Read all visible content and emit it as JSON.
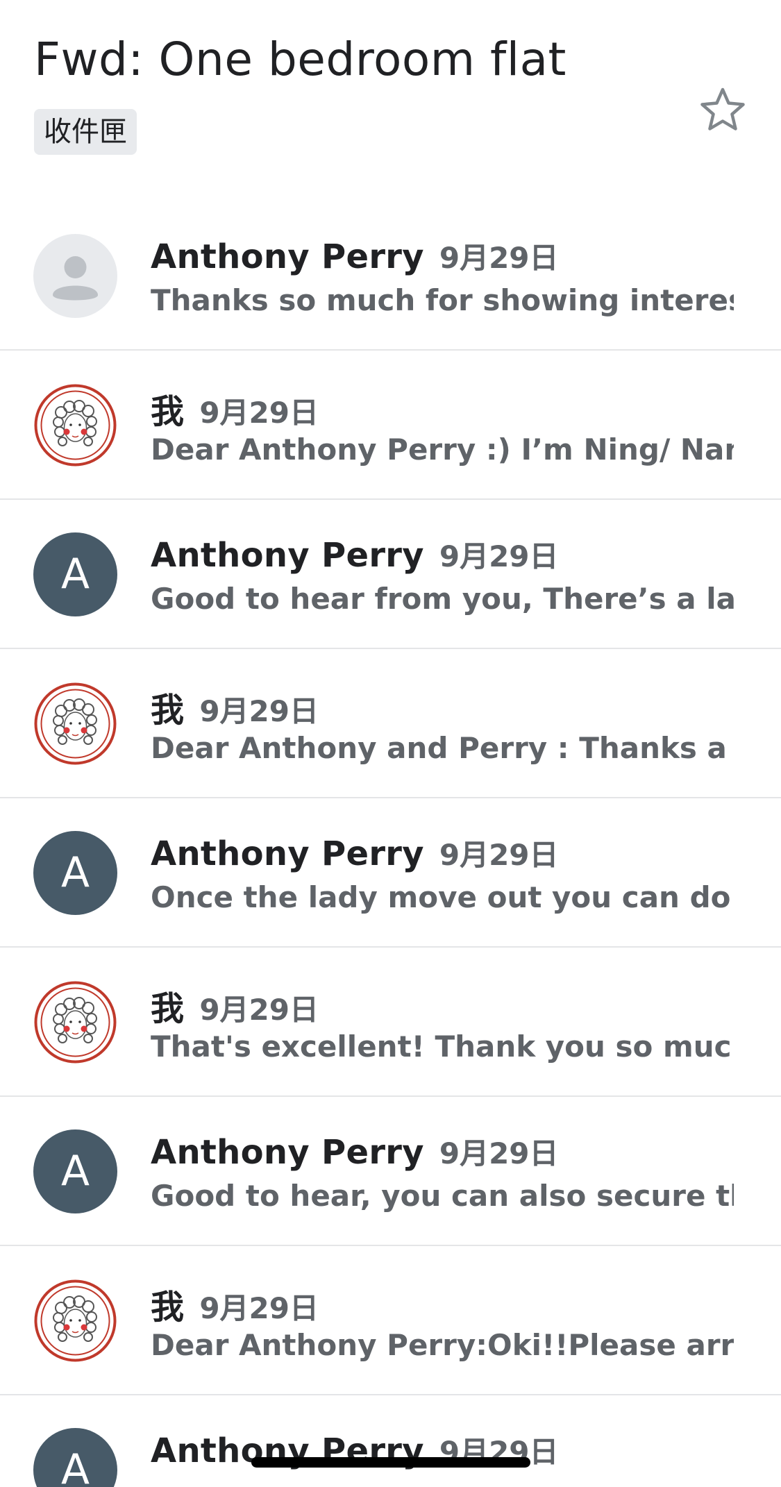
{
  "thread": {
    "subject": "Fwd: One bedroom flat",
    "label": "收件匣",
    "star_icon": "star-outline-icon"
  },
  "messages": [
    {
      "sender": "Anthony Perry",
      "date": "9月29日",
      "snippet": "Thanks so much for showing interest in...",
      "avatar": "default-person-icon"
    },
    {
      "sender": "我",
      "date": "9月29日",
      "snippet": "Dear Anthony Perry :) I’m Ning/ Nancy!...",
      "avatar": "user-photo"
    },
    {
      "sender": "Anthony Perry",
      "date": "9月29日",
      "snippet": "Good to hear from you, There’s a lady in...",
      "avatar": "letter",
      "avatar_letter": "A"
    },
    {
      "sender": "我",
      "date": "9月29日",
      "snippet": "Dear Anthony and Perry : Thanks a lot! :...",
      "avatar": "user-photo"
    },
    {
      "sender": "Anthony Perry",
      "date": "9月29日",
      "snippet": "Once the lady move out you can do a pr...",
      "avatar": "letter",
      "avatar_letter": "A"
    },
    {
      "sender": "我",
      "date": "9月29日",
      "snippet": "That's excellent! Thank you so much An...",
      "avatar": "user-photo"
    },
    {
      "sender": "Anthony Perry",
      "date": "9月29日",
      "snippet": "Good to hear, you can also secure the fl...",
      "avatar": "letter",
      "avatar_letter": "A"
    },
    {
      "sender": "我",
      "date": "9月29日",
      "snippet": "Dear Anthony Perry:Oki!!Please arrang...",
      "avatar": "user-photo"
    },
    {
      "sender": "Anthony Perry",
      "date": "9月29日",
      "snippet": "",
      "avatar": "letter",
      "avatar_letter": "A"
    }
  ],
  "colors": {
    "avatar_letter_bg": "#475a68",
    "photo_ring": "#c0392b",
    "divider": "#e4e5e7"
  }
}
